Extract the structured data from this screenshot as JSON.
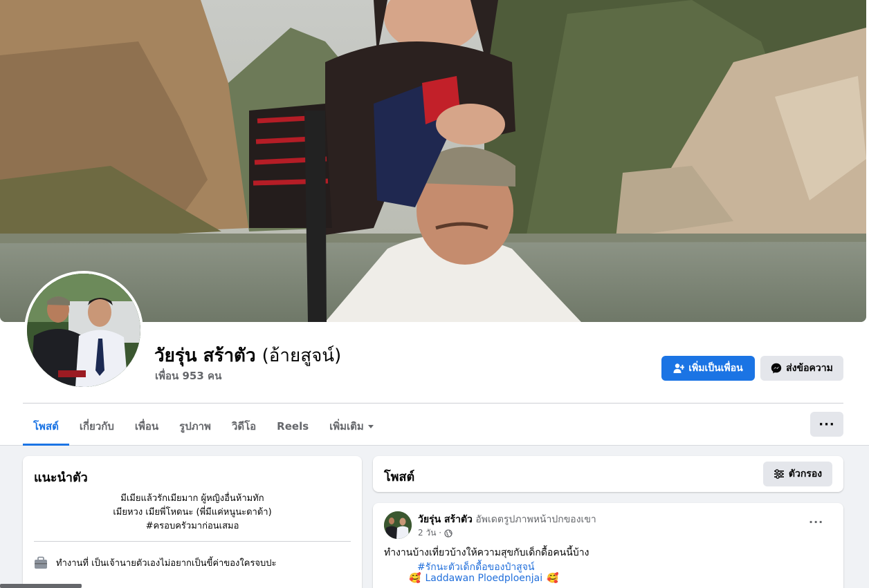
{
  "profile": {
    "name": "วัยรุ่น สร้าตัว",
    "alias": "(อ้ายสูจน์)",
    "friends": "เพื่อน 953 คน"
  },
  "actions": {
    "add_friend": "เพิ่มเป็นเพื่อน",
    "message": "ส่งข้อความ",
    "more": "···"
  },
  "tabs": [
    {
      "label": "โพสต์"
    },
    {
      "label": "เกี่ยวกับ"
    },
    {
      "label": "เพื่อน"
    },
    {
      "label": "รูปภาพ"
    },
    {
      "label": "วิดีโอ"
    },
    {
      "label": "Reels"
    },
    {
      "label": "เพิ่มเติม"
    }
  ],
  "intro": {
    "title": "แนะนำตัว",
    "bio_lines": [
      "มีเมียแล้วรักเมียมาก ผู้หญิงอื่นห้ามทัก",
      "เมียหวง เมียพี่โหดนะ (พี่มีแค่หนูนะดาด้า)",
      "#ครอบครัวมาก่อนเสมอ"
    ],
    "work": "ทำงานที่ เป็นเจ้านายตัวเองไม่อยากเป็นขี้ค่าของใครจบปะ"
  },
  "posts_section": {
    "title": "โพสต์",
    "filter": "ตัวกรอง"
  },
  "post": {
    "author": "วัยรุ่น สร้าตัว",
    "action": "อัพเดตรูปภาพหน้าปกของเขา",
    "time": "2 วัน ·",
    "menu": "···",
    "text": "ทำงานบ้างเที่ยวบ้างให้ความสุขกับเด็กดื้อคนนี้บ้าง",
    "hashtag": "#รักนะตัวเด็กดื้อของป๋าสูจน์",
    "mention": "Laddawan Ploedploenjai",
    "emoji": "🥰"
  },
  "colors": {
    "primary": "#1b74e4",
    "secondary_bg": "#e4e6eb",
    "muted_text": "#65676b",
    "link": "#216fdb"
  }
}
